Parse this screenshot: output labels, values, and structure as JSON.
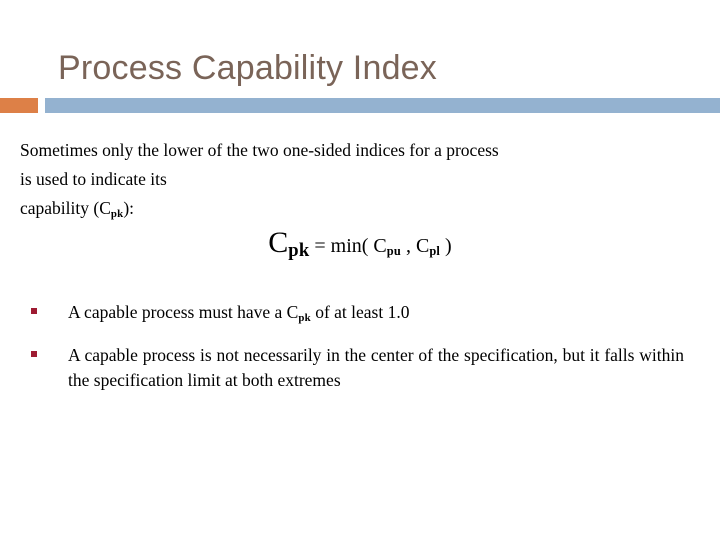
{
  "slide": {
    "title": "Process Capability Index",
    "theme": {
      "title_color": "#7a6458",
      "accent_orange": "#dd8047",
      "accent_blue": "#94b2d0",
      "bullet_color": "#9e1b32",
      "body_color": "#000000",
      "background": "#ffffff"
    },
    "intro": {
      "line1": "Sometimes only the lower of the two one-sided indices for a process",
      "line2": "is used to indicate its",
      "line3_prefix": "capability (C",
      "line3_sub": "pk",
      "line3_suffix": "):"
    },
    "formula": {
      "lead_letter": "C",
      "lead_sub": "pk",
      "operator": " = min( C",
      "arg1_sub": "pu",
      "separator": " , C",
      "arg2_sub": "pl",
      "close": " )"
    },
    "bullets": [
      {
        "marker": "square-bullet",
        "text_before": "A capable process must have a C",
        "sub": "pk",
        "text_after": " of at least 1.0",
        "justified": false
      },
      {
        "marker": "square-bullet",
        "text": "A capable process is not necessarily in the center of the specification, but it falls within the specification limit at both extremes",
        "justified": true
      }
    ]
  }
}
